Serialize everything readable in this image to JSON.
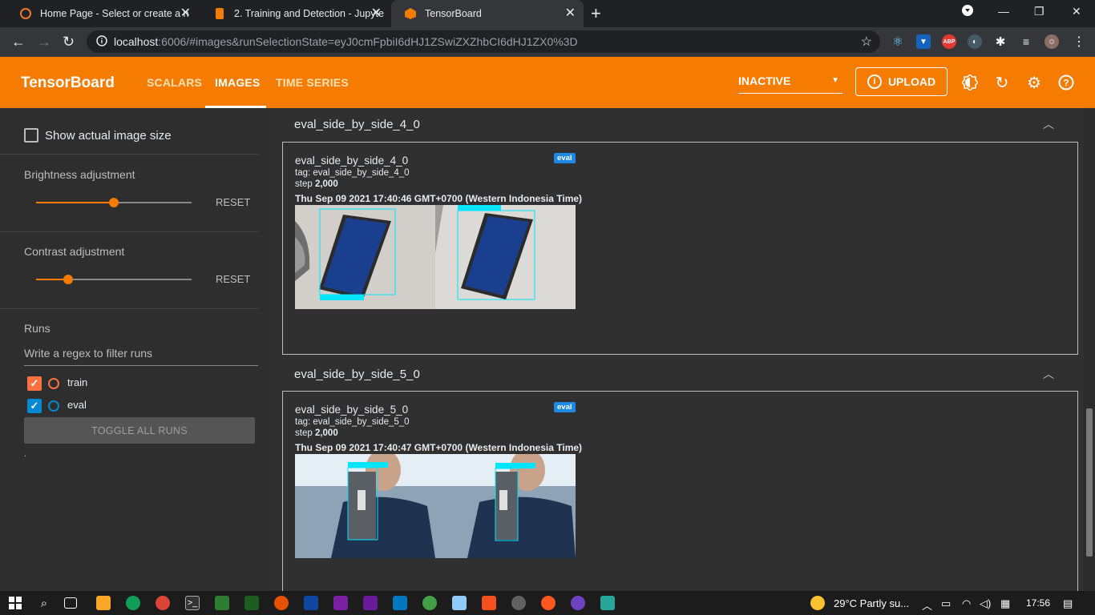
{
  "browser": {
    "tabs": [
      {
        "label": "Home Page - Select or create a n",
        "icon": "jupyter-icon"
      },
      {
        "label": "2. Training and Detection - Jupyte",
        "icon": "notebook-icon"
      },
      {
        "label": "TensorBoard",
        "icon": "tensorboard-icon"
      }
    ],
    "url_host": "localhost",
    "url_rest": ":6006/#images&runSelectionState=eyJ0cmFpbiI6dHJ1ZSwiZXZhbCI6dHJ1ZX0%3D",
    "ext_abp": "ABP"
  },
  "header": {
    "logo": "TensorBoard",
    "tabs": [
      "SCALARS",
      "IMAGES",
      "TIME SERIES"
    ],
    "status": "INACTIVE",
    "upload": "UPLOAD",
    "accent": "#f57c00"
  },
  "sidebar": {
    "show_actual_size": "Show actual image size",
    "brightness_label": "Brightness adjustment",
    "brightness_value": 0.5,
    "contrast_label": "Contrast adjustment",
    "contrast_value": 0.2,
    "reset": "RESET",
    "runs_title": "Runs",
    "filter_placeholder": "Write a regex to filter runs",
    "runs": [
      {
        "name": "train",
        "checked": true,
        "color": "#ff7043"
      },
      {
        "name": "eval",
        "checked": true,
        "color": "#0288d1"
      }
    ],
    "toggle_all": "TOGGLE ALL RUNS",
    "dot": "."
  },
  "main": {
    "groups": [
      {
        "title": "eval_side_by_side_4_0",
        "card_title": "eval_side_by_side_4_0",
        "badge": "eval",
        "tag": "tag: eval_side_by_side_4_0",
        "step_label": "step ",
        "step_value": "2,000",
        "time": "Thu Sep 09 2021 17:40:46 GMT+0700 (Western Indonesia Time)"
      },
      {
        "title": "eval_side_by_side_5_0",
        "card_title": "eval_side_by_side_5_0",
        "badge": "eval",
        "tag": "tag: eval_side_by_side_5_0",
        "step_label": "step ",
        "step_value": "2,000",
        "time": "Thu Sep 09 2021 17:40:47 GMT+0700 (Western Indonesia Time)"
      }
    ]
  },
  "taskbar": {
    "weather": "29°C  Partly su...",
    "clock": "17:56"
  }
}
